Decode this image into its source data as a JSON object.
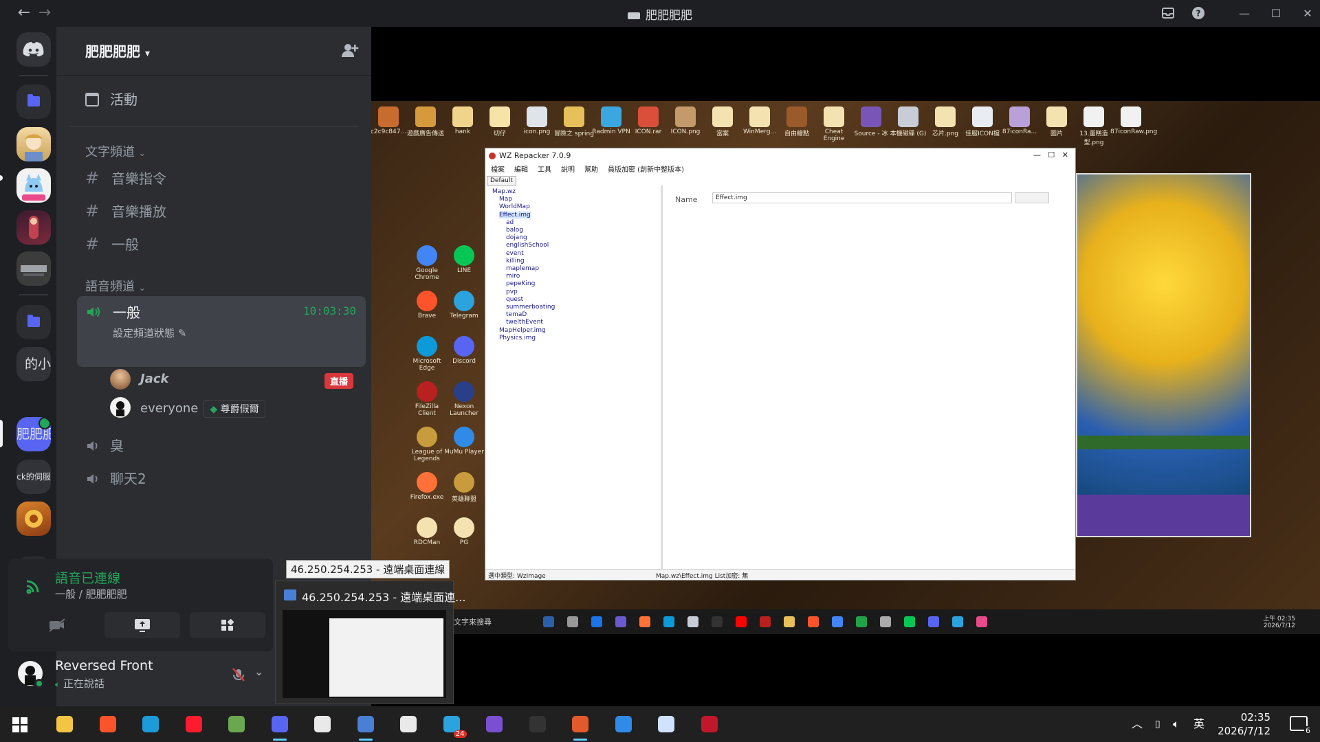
{
  "titlebar": {
    "title": "肥肥肥肥"
  },
  "rail": {
    "labels": [
      "的小",
      "肥肥肥",
      "ck的伺服"
    ]
  },
  "sidebar": {
    "guild_name": "肥肥肥肥",
    "event_label": "活動",
    "text_category": "文字頻道",
    "text_channels": [
      "音樂指令",
      "音樂播放",
      "一般"
    ],
    "voice_category": "語音頻道",
    "active_voice": {
      "name": "一般",
      "time": "10:03:30",
      "status": "設定頻道狀態"
    },
    "voice_users": [
      {
        "name": "Jack",
        "badge": "直播"
      },
      {
        "name": "everyone",
        "activity": "尊爵假爾"
      }
    ],
    "voice_channels": [
      "臭",
      "聊天2"
    ]
  },
  "voice_panel": {
    "title": "語音已連線",
    "subtitle": "一般 / 肥肥肥肥"
  },
  "user_panel": {
    "name": "Reversed Front",
    "status": "正在說話"
  },
  "remote": {
    "desktop_icons": [
      "c2c9c847...",
      "遊戲廣告傳送",
      "hank",
      "切仔",
      "icon.png",
      "冒險之 spring",
      "Radmin VPN",
      "ICON.rar",
      "ICON.png",
      "當案",
      "WinMerg...",
      "自由繪點",
      "Cheat Engine",
      "Source - 冰",
      "本機磁碟 (G)",
      "芯片.png",
      "佳服ICON檔",
      "87iconRa...",
      "圖片",
      "13.蛋糕造型.png",
      "87iconRaw.png"
    ],
    "left_icons": [
      "Google Chrome",
      "LINE",
      "Brave",
      "Telegram",
      "Microsoft Edge",
      "Discord",
      "FileZilla Client",
      "Nexon Launcher",
      "League of Legends",
      "MuMu Player",
      "Firefox.exe",
      "英雄聯盟",
      "RDCMan",
      "PG"
    ],
    "wz": {
      "title": "WZ Repacker 7.0.9",
      "menu": [
        "檔案",
        "編輯",
        "工具",
        "說明",
        "幫助",
        "員版加密 (創新中整版本)"
      ],
      "tab": "Default",
      "tree": [
        "Map.wz",
        "Map",
        "WorldMap",
        "Effect.img",
        "ad",
        "balog",
        "dojang",
        "englishSchool",
        "event",
        "killing",
        "maplemap",
        "miro",
        "pepeKing",
        "pvp",
        "quest",
        "summerboating",
        "temaD",
        "twelthEvent",
        "MapHelper.img",
        "Physics.img"
      ],
      "name_label": "Name",
      "name_value": "Effect.img",
      "status_left": "選中類型: WzImage",
      "status_right": "Map.wz\\Effect.img List加密: 無"
    },
    "search_text": "文字來搜尋",
    "clock_time": "上午 02:35",
    "clock_date": "2026/7/12"
  },
  "tooltip": "46.250.254.253 - 遠端桌面連線",
  "preview_title": "46.250.254.253 - 遠端桌面連...",
  "taskbar": {
    "time": "02:35",
    "date": "2026/7/12",
    "ime": "英",
    "notif_count": "6",
    "telegram_badge": "24"
  }
}
